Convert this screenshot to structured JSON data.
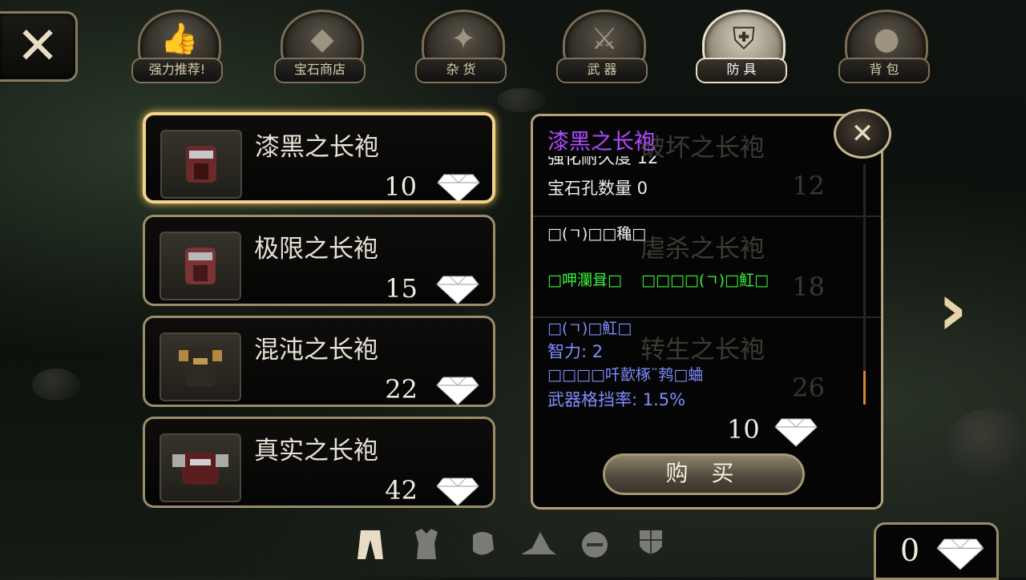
{
  "top": {
    "close_icon": "close-x-icon",
    "tabs": [
      {
        "label": "强力推荐!",
        "icon": "thumbs-up-icon",
        "active": false
      },
      {
        "label": "宝石商店",
        "icon": "gem-icon",
        "active": false
      },
      {
        "label": "杂 货",
        "icon": "compass-icon",
        "active": false
      },
      {
        "label": "武 器",
        "icon": "sword-icon",
        "active": false
      },
      {
        "label": "防 具",
        "icon": "shield-icon",
        "active": true
      },
      {
        "label": "背 包",
        "icon": "bag-icon",
        "active": false
      }
    ]
  },
  "items": [
    {
      "name": "漆黑之长袍",
      "price": "10",
      "selected": true
    },
    {
      "name": "极限之长袍",
      "price": "15",
      "selected": false
    },
    {
      "name": "混沌之长袍",
      "price": "22",
      "selected": false
    },
    {
      "name": "真实之长袍",
      "price": "42",
      "selected": false
    }
  ],
  "detail": {
    "title": "漆黑之长袍",
    "partial_line": "强化耐久度 12",
    "gem_slots": "宝石孔数量 0",
    "section1_title": "□(ㄱ)□□穐□",
    "section1_green": "□呷瀾咠□    □□□□(ㄱ)□魟□",
    "section2_title": "□(ㄱ)□魟□",
    "stat_int": "智力: 2",
    "stat_garbled": "□□□□吀歖椓¨鹁□蛐",
    "stat_block": "武器格挡率: 1.5%",
    "price": "10",
    "buy_label": "购 买",
    "ghost_rows": [
      {
        "name": "破坏之长袍",
        "price": "12"
      },
      {
        "name": "虐杀之长袍",
        "price": "18"
      },
      {
        "name": "转生之长袍",
        "price": "26"
      }
    ]
  },
  "bottom": {
    "filters": [
      {
        "icon": "robe-icon",
        "active": true
      },
      {
        "icon": "armor-icon",
        "active": false
      },
      {
        "icon": "gauntlet-icon",
        "active": false
      },
      {
        "icon": "hat-icon",
        "active": false
      },
      {
        "icon": "helmet-icon",
        "active": false
      },
      {
        "icon": "shield-small-icon",
        "active": false
      }
    ]
  },
  "currency": {
    "value": "0"
  },
  "colors": {
    "title_purple": "#b04cff",
    "green_text": "#3cf23c",
    "blue_text": "#7f8dff",
    "gold_border": "#f3d28a"
  }
}
